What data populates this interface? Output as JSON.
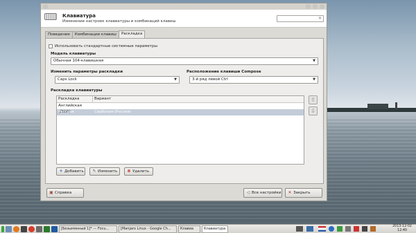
{
  "window": {
    "title": "Клавиатура",
    "subtitle": "Изменение настроек клавиатуры и комбинаций клавиш",
    "search_placeholder": ""
  },
  "tabs": [
    {
      "label": "Поведение"
    },
    {
      "label": "Комбинации клавиш"
    },
    {
      "label": "Раскладка"
    }
  ],
  "layout_tab": {
    "use_system_defaults": "Использовать стандартные системные параметры",
    "use_system_defaults_checked": false,
    "model_label": "Модель клавиатуры",
    "model_value": "Обычная 104-клавишная",
    "change_layout_label": "Изменить параметры раскладки",
    "change_layout_value": "Caps Lock",
    "compose_label": "Расположение клавиши Compose",
    "compose_value": "3-й ряд левой Ctrl",
    "layout_section_label": "Раскладка клавиатуры",
    "columns": [
      "Раскладка",
      "Вариант"
    ],
    "rows": [
      {
        "layout": "Английская (США)",
        "variant": ""
      },
      {
        "layout": "Русская",
        "variant": "Сербская (Россия)"
      }
    ],
    "selected_row": 1,
    "add_label": "Добавить",
    "edit_label": "Изменить",
    "remove_label": "Удалить"
  },
  "footer": {
    "help_label": "Справка",
    "all_settings_label": "Все настройки",
    "close_label": "Закрыть"
  },
  "taskbar": {
    "tasks": [
      {
        "label": "[Безымянный 1]* — Focu..."
      },
      {
        "label": "[Manjaro Linux - Google Ch..."
      },
      {
        "label": "Клавиа"
      },
      {
        "label": "Клавиатура"
      }
    ],
    "clock_date": "2013-12-02",
    "clock_time": "12:40"
  },
  "colors": {
    "selection": "#c3ccd8",
    "window_bg": "#dcdad5"
  }
}
